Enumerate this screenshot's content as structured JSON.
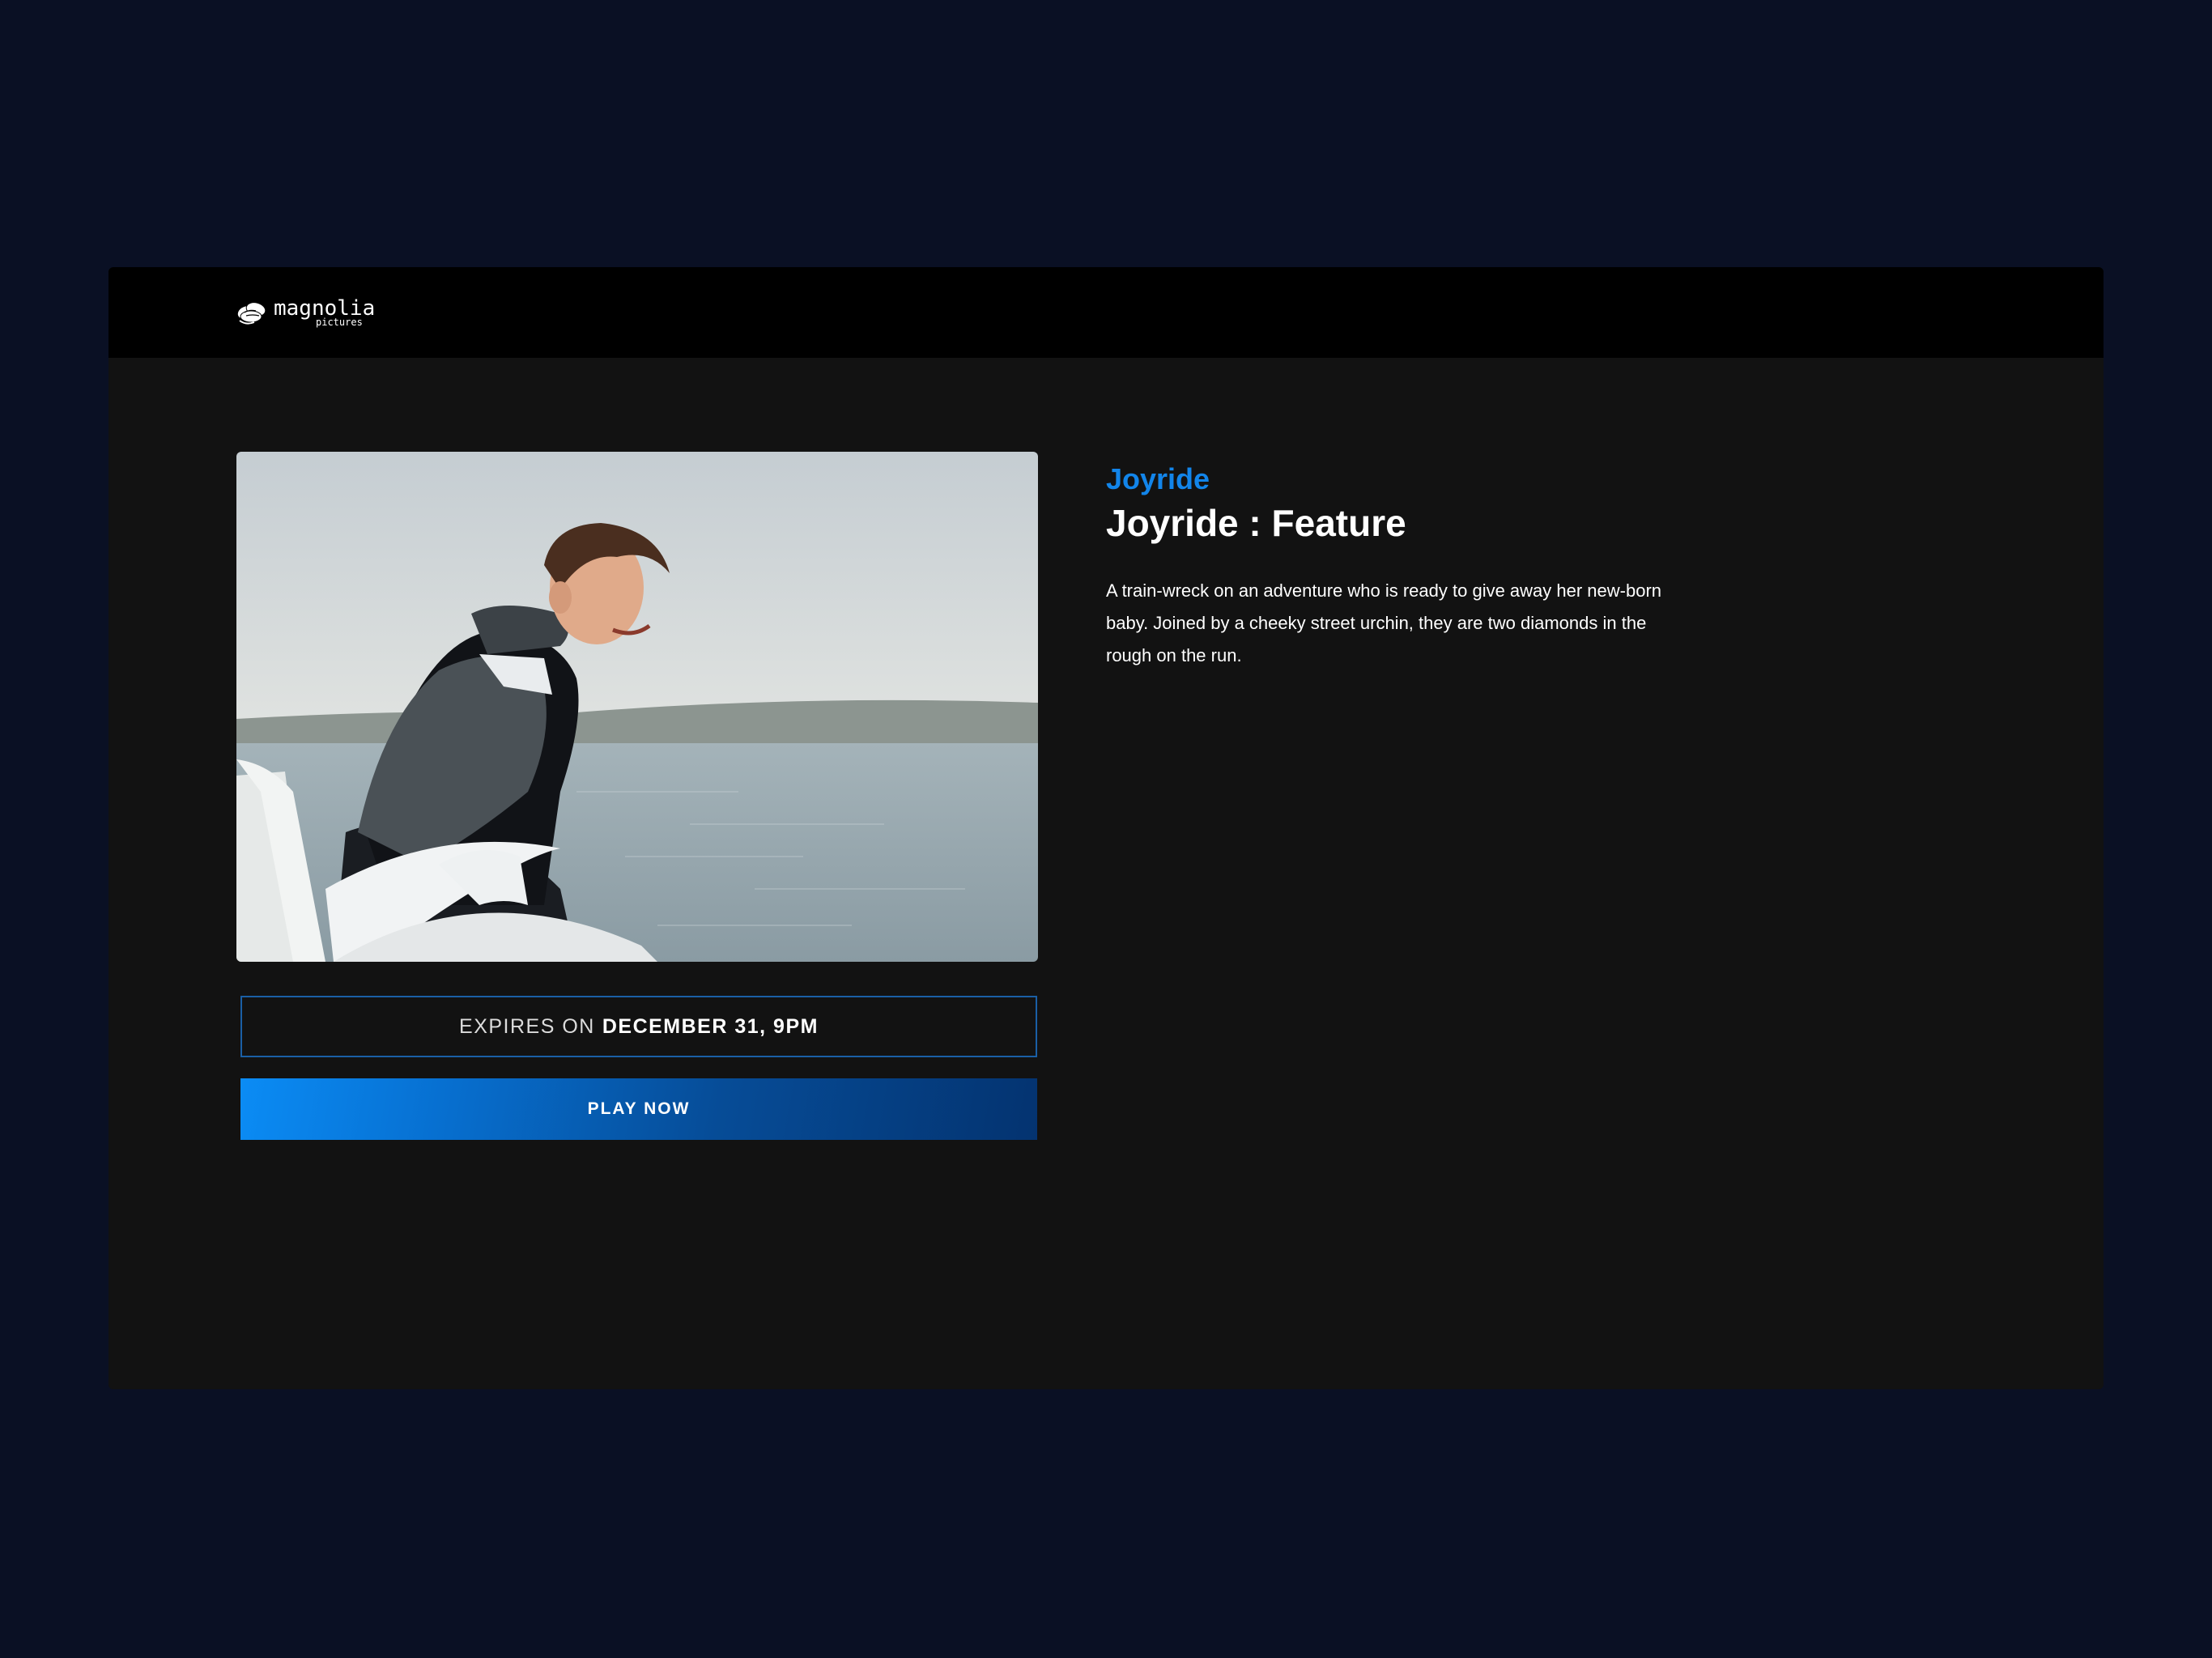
{
  "header": {
    "logo_word": "magnolia",
    "logo_sub": "pictures"
  },
  "title": {
    "series": "Joyride",
    "episode": "Joyride : Feature",
    "description": "A train-wreck on an adventure who is ready to give away her new-born baby. Joined by a cheeky street urchin, they are two diamonds in the rough on the run."
  },
  "expires": {
    "prefix": "EXPIRES ON",
    "date": "DECEMBER 31, 9PM"
  },
  "actions": {
    "play_label": "PLAY NOW"
  },
  "colors": {
    "page_bg": "#0a1024",
    "panel_bg": "#121212",
    "topbar_bg": "#000000",
    "accent": "#1285ea",
    "border": "#1a5fa5"
  }
}
